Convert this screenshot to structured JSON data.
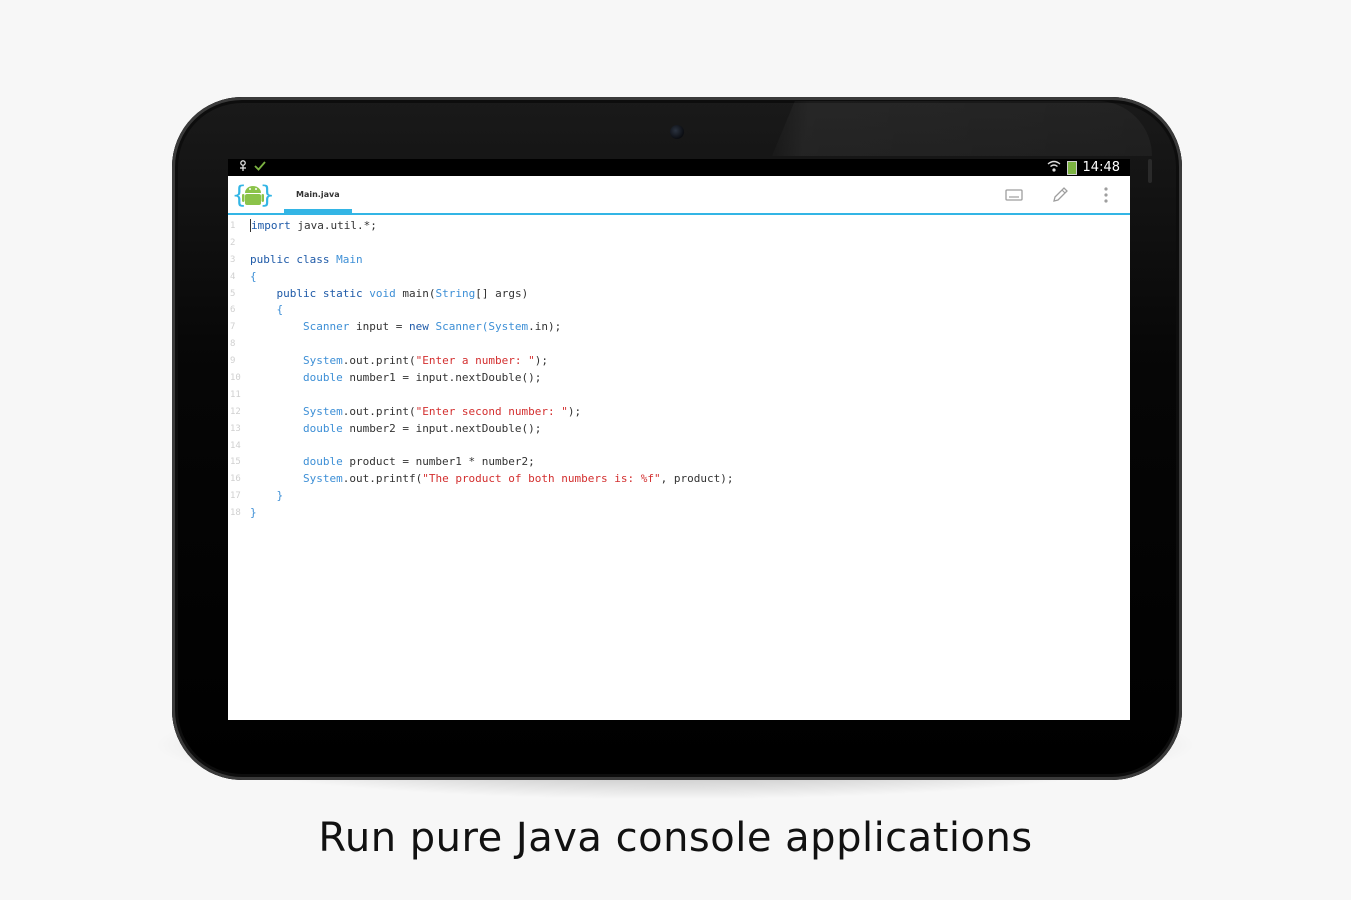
{
  "caption": "Run pure Java console applications",
  "status_bar": {
    "time": "14:48",
    "left_icons": [
      "usb-debug-icon",
      "check-icon"
    ],
    "right_icons": [
      "wifi-icon",
      "battery-icon"
    ]
  },
  "action_bar": {
    "tab_label": "Main.java",
    "actions": [
      "keyboard-icon",
      "pencil-icon",
      "overflow-menu-icon"
    ]
  },
  "colors": {
    "accent": "#33b5e5",
    "keyword": "#1e5aa8",
    "type": "#3d8fd6",
    "string": "#d32f2f"
  },
  "editor": {
    "lines": [
      {
        "n": "1",
        "tokens": [
          {
            "t": "import",
            "c": "kw"
          },
          {
            "t": " java.util.*;",
            "c": ""
          }
        ]
      },
      {
        "n": "2",
        "tokens": []
      },
      {
        "n": "3",
        "tokens": [
          {
            "t": "public class ",
            "c": "kw"
          },
          {
            "t": "Main",
            "c": "ty"
          }
        ]
      },
      {
        "n": "4",
        "tokens": [
          {
            "t": "{",
            "c": "ty"
          }
        ]
      },
      {
        "n": "5",
        "tokens": [
          {
            "t": "    public static ",
            "c": "kw"
          },
          {
            "t": "void",
            "c": "ty"
          },
          {
            "t": " main(",
            "c": ""
          },
          {
            "t": "String",
            "c": "ty"
          },
          {
            "t": "[] args)",
            "c": ""
          }
        ]
      },
      {
        "n": "6",
        "tokens": [
          {
            "t": "    {",
            "c": "ty"
          }
        ]
      },
      {
        "n": "7",
        "tokens": [
          {
            "t": "        Scanner",
            "c": "ty"
          },
          {
            "t": " input = ",
            "c": ""
          },
          {
            "t": "new ",
            "c": "kw"
          },
          {
            "t": "Scanner(System",
            "c": "ty"
          },
          {
            "t": ".in);",
            "c": ""
          }
        ]
      },
      {
        "n": "8",
        "tokens": []
      },
      {
        "n": "9",
        "tokens": [
          {
            "t": "        System",
            "c": "ty"
          },
          {
            "t": ".out.print(",
            "c": ""
          },
          {
            "t": "\"Enter a number: \"",
            "c": "st"
          },
          {
            "t": ");",
            "c": ""
          }
        ]
      },
      {
        "n": "10",
        "tokens": [
          {
            "t": "        double",
            "c": "ty"
          },
          {
            "t": " number1 = input.nextDouble();",
            "c": ""
          }
        ]
      },
      {
        "n": "11",
        "tokens": []
      },
      {
        "n": "12",
        "tokens": [
          {
            "t": "        System",
            "c": "ty"
          },
          {
            "t": ".out.print(",
            "c": ""
          },
          {
            "t": "\"Enter second number: \"",
            "c": "st"
          },
          {
            "t": ");",
            "c": ""
          }
        ]
      },
      {
        "n": "13",
        "tokens": [
          {
            "t": "        double",
            "c": "ty"
          },
          {
            "t": " number2 = input.nextDouble();",
            "c": ""
          }
        ]
      },
      {
        "n": "14",
        "tokens": []
      },
      {
        "n": "15",
        "tokens": [
          {
            "t": "        double",
            "c": "ty"
          },
          {
            "t": " product = number1 * number2;",
            "c": ""
          }
        ]
      },
      {
        "n": "16",
        "tokens": [
          {
            "t": "        System",
            "c": "ty"
          },
          {
            "t": ".out.printf(",
            "c": ""
          },
          {
            "t": "\"The product of both numbers is: %f\"",
            "c": "st"
          },
          {
            "t": ", product);",
            "c": ""
          }
        ]
      },
      {
        "n": "17",
        "tokens": [
          {
            "t": "    }",
            "c": "ty"
          }
        ]
      },
      {
        "n": "18",
        "tokens": [
          {
            "t": "}",
            "c": "ty"
          }
        ]
      }
    ]
  }
}
